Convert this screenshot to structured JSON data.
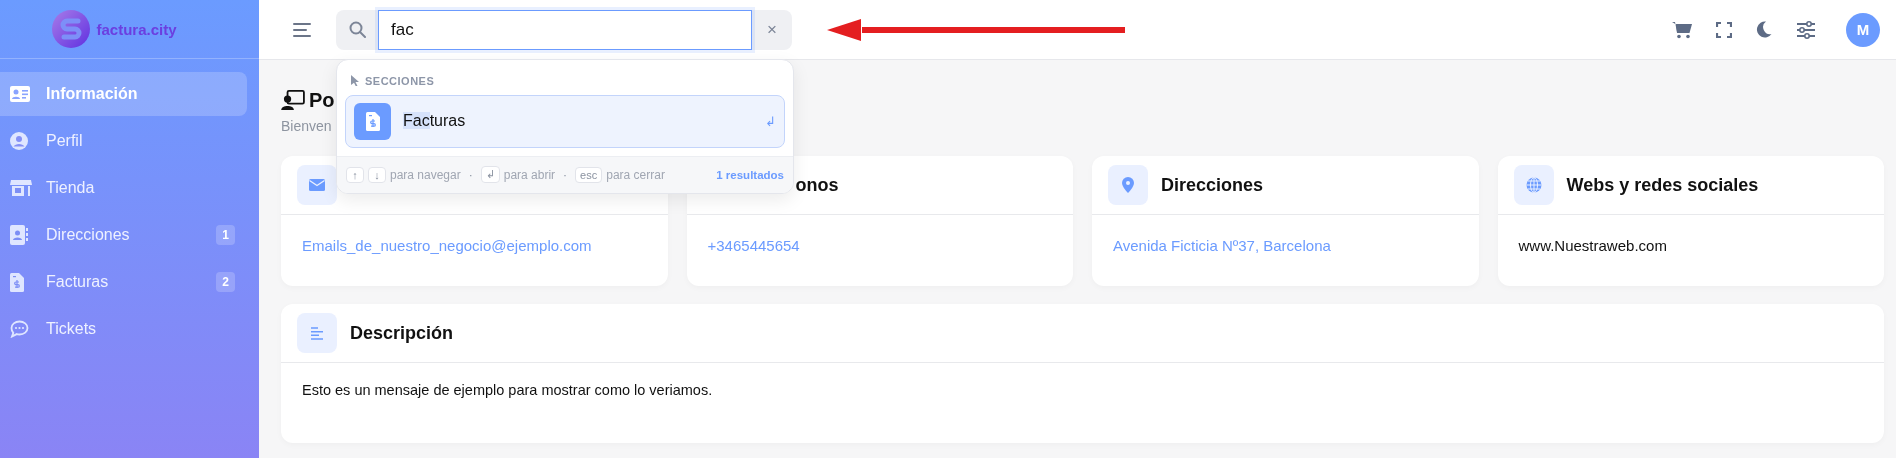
{
  "brand": {
    "name": "factura.city"
  },
  "sidebar": {
    "items": [
      {
        "label": "Información",
        "selected": true
      },
      {
        "label": "Perfil",
        "selected": false
      },
      {
        "label": "Tienda",
        "selected": false
      },
      {
        "label": "Direcciones",
        "selected": false,
        "badge": "1"
      },
      {
        "label": "Facturas",
        "selected": false,
        "badge": "2"
      },
      {
        "label": "Tickets",
        "selected": false
      }
    ]
  },
  "header": {
    "search": {
      "value": "fac",
      "clear": "×"
    },
    "avatar": "M"
  },
  "search_results": {
    "section": "SECCIONES",
    "results": [
      {
        "match": "Fac",
        "rest": "turas",
        "enter": "↲",
        "selected": true
      }
    ],
    "hints": [
      {
        "keys": [
          "↑",
          "↓"
        ],
        "text": "para navegar"
      },
      {
        "keys": [
          "↲"
        ],
        "text": "para abrir"
      },
      {
        "keys": [
          "esc"
        ],
        "text": "para cerrar"
      }
    ],
    "separator": "·",
    "count": "1 resultados"
  },
  "page": {
    "title": "Po",
    "subtitle": "Bienven"
  },
  "cards": [
    {
      "value": "Emails_de_nuestro_negocio@ejemplo.com",
      "link": true
    },
    {
      "title": "onos",
      "value": "+3465445654",
      "link": true
    },
    {
      "title": "Direcciones",
      "value": "Avenida Ficticia Nº37, Barcelona",
      "link": true
    },
    {
      "title": "Webs y redes sociales",
      "value": "www.Nuestraweb.com",
      "link": false
    }
  ],
  "description": {
    "title": "Descripción",
    "text": "Esto es un mensaje de ejemplo para mostrar como lo veriamos."
  }
}
